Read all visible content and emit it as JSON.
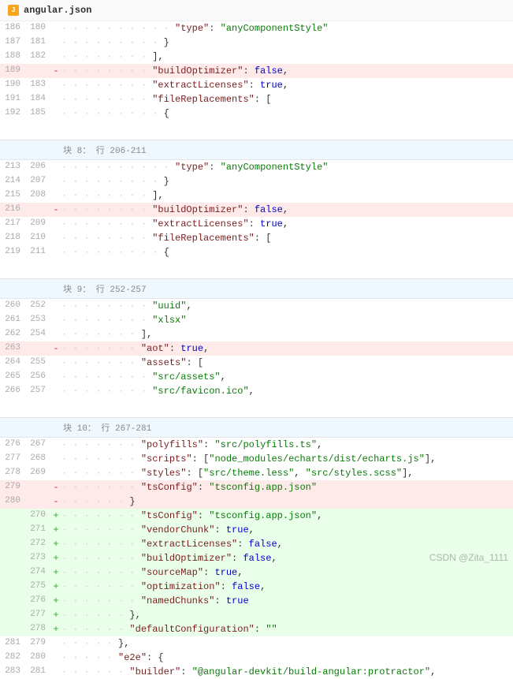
{
  "file": {
    "name": "angular.json",
    "icon_label": "J"
  },
  "watermark": "CSDN @Zita_1111",
  "hunks": [
    {
      "header": "",
      "lines": [
        {
          "old": "186",
          "new": "180",
          "type": "ctx",
          "indent": 20,
          "tokens": [
            [
              "key",
              "\"type\""
            ],
            [
              "punc",
              ": "
            ],
            [
              "str",
              "\"anyComponentStyle\""
            ]
          ]
        },
        {
          "old": "187",
          "new": "181",
          "type": "ctx",
          "indent": 18,
          "tokens": [
            [
              "punc",
              "}"
            ]
          ]
        },
        {
          "old": "188",
          "new": "182",
          "type": "ctx",
          "indent": 16,
          "tokens": [
            [
              "punc",
              "],"
            ]
          ]
        },
        {
          "old": "189",
          "new": "",
          "type": "del",
          "indent": 16,
          "tokens": [
            [
              "key",
              "\"buildOptimizer\""
            ],
            [
              "punc",
              ": "
            ],
            [
              "bool",
              "false"
            ],
            [
              "punc",
              ","
            ]
          ]
        },
        {
          "old": "190",
          "new": "183",
          "type": "ctx",
          "indent": 16,
          "tokens": [
            [
              "key",
              "\"extractLicenses\""
            ],
            [
              "punc",
              ": "
            ],
            [
              "bool",
              "true"
            ],
            [
              "punc",
              ","
            ]
          ]
        },
        {
          "old": "191",
          "new": "184",
          "type": "ctx",
          "indent": 16,
          "tokens": [
            [
              "key",
              "\"fileReplacements\""
            ],
            [
              "punc",
              ": ["
            ]
          ]
        },
        {
          "old": "192",
          "new": "185",
          "type": "ctx",
          "indent": 18,
          "tokens": [
            [
              "punc",
              "{"
            ]
          ]
        }
      ]
    },
    {
      "header": "块 8： 行 206-211",
      "lines": [
        {
          "old": "213",
          "new": "206",
          "type": "ctx",
          "indent": 20,
          "tokens": [
            [
              "key",
              "\"type\""
            ],
            [
              "punc",
              ": "
            ],
            [
              "str",
              "\"anyComponentStyle\""
            ]
          ]
        },
        {
          "old": "214",
          "new": "207",
          "type": "ctx",
          "indent": 18,
          "tokens": [
            [
              "punc",
              "}"
            ]
          ]
        },
        {
          "old": "215",
          "new": "208",
          "type": "ctx",
          "indent": 16,
          "tokens": [
            [
              "punc",
              "],"
            ]
          ]
        },
        {
          "old": "216",
          "new": "",
          "type": "del",
          "indent": 16,
          "tokens": [
            [
              "key",
              "\"buildOptimizer\""
            ],
            [
              "punc",
              ": "
            ],
            [
              "bool",
              "false"
            ],
            [
              "punc",
              ","
            ]
          ]
        },
        {
          "old": "217",
          "new": "209",
          "type": "ctx",
          "indent": 16,
          "tokens": [
            [
              "key",
              "\"extractLicenses\""
            ],
            [
              "punc",
              ": "
            ],
            [
              "bool",
              "true"
            ],
            [
              "punc",
              ","
            ]
          ]
        },
        {
          "old": "218",
          "new": "210",
          "type": "ctx",
          "indent": 16,
          "tokens": [
            [
              "key",
              "\"fileReplacements\""
            ],
            [
              "punc",
              ": ["
            ]
          ]
        },
        {
          "old": "219",
          "new": "211",
          "type": "ctx",
          "indent": 18,
          "tokens": [
            [
              "punc",
              "{"
            ]
          ]
        }
      ]
    },
    {
      "header": "块 9： 行 252-257",
      "lines": [
        {
          "old": "260",
          "new": "252",
          "type": "ctx",
          "indent": 16,
          "tokens": [
            [
              "str",
              "\"uuid\""
            ],
            [
              "punc",
              ","
            ]
          ]
        },
        {
          "old": "261",
          "new": "253",
          "type": "ctx",
          "indent": 16,
          "tokens": [
            [
              "str",
              "\"xlsx\""
            ]
          ]
        },
        {
          "old": "262",
          "new": "254",
          "type": "ctx",
          "indent": 14,
          "tokens": [
            [
              "punc",
              "],"
            ]
          ]
        },
        {
          "old": "263",
          "new": "",
          "type": "del",
          "indent": 14,
          "tokens": [
            [
              "key",
              "\"aot\""
            ],
            [
              "punc",
              ": "
            ],
            [
              "bool",
              "true"
            ],
            [
              "punc",
              ","
            ]
          ]
        },
        {
          "old": "264",
          "new": "255",
          "type": "ctx",
          "indent": 14,
          "tokens": [
            [
              "key",
              "\"assets\""
            ],
            [
              "punc",
              ": ["
            ]
          ]
        },
        {
          "old": "265",
          "new": "256",
          "type": "ctx",
          "indent": 16,
          "tokens": [
            [
              "str",
              "\"src/assets\""
            ],
            [
              "punc",
              ","
            ]
          ]
        },
        {
          "old": "266",
          "new": "257",
          "type": "ctx",
          "indent": 16,
          "tokens": [
            [
              "str",
              "\"src/favicon.ico\""
            ],
            [
              "punc",
              ","
            ]
          ]
        }
      ]
    },
    {
      "header": "块 10： 行 267-281",
      "lines": [
        {
          "old": "276",
          "new": "267",
          "type": "ctx",
          "indent": 14,
          "tokens": [
            [
              "key",
              "\"polyfills\""
            ],
            [
              "punc",
              ": "
            ],
            [
              "str",
              "\"src/polyfills.ts\""
            ],
            [
              "punc",
              ","
            ]
          ]
        },
        {
          "old": "277",
          "new": "268",
          "type": "ctx",
          "indent": 14,
          "tokens": [
            [
              "key",
              "\"scripts\""
            ],
            [
              "punc",
              ": ["
            ],
            [
              "str",
              "\"node_modules/echarts/dist/echarts.js\""
            ],
            [
              "punc",
              "],"
            ]
          ]
        },
        {
          "old": "278",
          "new": "269",
          "type": "ctx",
          "indent": 14,
          "tokens": [
            [
              "key",
              "\"styles\""
            ],
            [
              "punc",
              ": ["
            ],
            [
              "str",
              "\"src/theme.less\""
            ],
            [
              "punc",
              ", "
            ],
            [
              "str",
              "\"src/styles.scss\""
            ],
            [
              "punc",
              "],"
            ]
          ]
        },
        {
          "old": "279",
          "new": "",
          "type": "del",
          "indent": 14,
          "tokens": [
            [
              "key",
              "\"tsConfig\""
            ],
            [
              "punc",
              ": "
            ],
            [
              "str",
              "\"tsconfig.app.json\""
            ]
          ]
        },
        {
          "old": "280",
          "new": "",
          "type": "del",
          "indent": 12,
          "tokens": [
            [
              "punc",
              "}"
            ]
          ]
        },
        {
          "old": "",
          "new": "270",
          "type": "add",
          "indent": 14,
          "tokens": [
            [
              "key",
              "\"tsConfig\""
            ],
            [
              "punc",
              ": "
            ],
            [
              "str",
              "\"tsconfig.app.json\""
            ],
            [
              "punc",
              ","
            ]
          ]
        },
        {
          "old": "",
          "new": "271",
          "type": "add",
          "indent": 14,
          "tokens": [
            [
              "key",
              "\"vendorChunk\""
            ],
            [
              "punc",
              ": "
            ],
            [
              "bool",
              "true"
            ],
            [
              "punc",
              ","
            ]
          ]
        },
        {
          "old": "",
          "new": "272",
          "type": "add",
          "indent": 14,
          "tokens": [
            [
              "key",
              "\"extractLicenses\""
            ],
            [
              "punc",
              ": "
            ],
            [
              "bool",
              "false"
            ],
            [
              "punc",
              ","
            ]
          ]
        },
        {
          "old": "",
          "new": "273",
          "type": "add",
          "indent": 14,
          "tokens": [
            [
              "key",
              "\"buildOptimizer\""
            ],
            [
              "punc",
              ": "
            ],
            [
              "bool",
              "false"
            ],
            [
              "punc",
              ","
            ]
          ]
        },
        {
          "old": "",
          "new": "274",
          "type": "add",
          "indent": 14,
          "tokens": [
            [
              "key",
              "\"sourceMap\""
            ],
            [
              "punc",
              ": "
            ],
            [
              "bool",
              "true"
            ],
            [
              "punc",
              ","
            ]
          ]
        },
        {
          "old": "",
          "new": "275",
          "type": "add",
          "indent": 14,
          "tokens": [
            [
              "key",
              "\"optimization\""
            ],
            [
              "punc",
              ": "
            ],
            [
              "bool",
              "false"
            ],
            [
              "punc",
              ","
            ]
          ]
        },
        {
          "old": "",
          "new": "276",
          "type": "add",
          "indent": 14,
          "tokens": [
            [
              "key",
              "\"namedChunks\""
            ],
            [
              "punc",
              ": "
            ],
            [
              "bool",
              "true"
            ]
          ]
        },
        {
          "old": "",
          "new": "277",
          "type": "add",
          "indent": 12,
          "tokens": [
            [
              "punc",
              "},"
            ]
          ]
        },
        {
          "old": "",
          "new": "278",
          "type": "add",
          "indent": 12,
          "tokens": [
            [
              "key",
              "\"defaultConfiguration\""
            ],
            [
              "punc",
              ": "
            ],
            [
              "str",
              "\"\""
            ]
          ]
        },
        {
          "old": "281",
          "new": "279",
          "type": "ctx",
          "indent": 10,
          "tokens": [
            [
              "punc",
              "},"
            ]
          ]
        },
        {
          "old": "282",
          "new": "280",
          "type": "ctx",
          "indent": 10,
          "tokens": [
            [
              "key",
              "\"e2e\""
            ],
            [
              "punc",
              ": {"
            ]
          ]
        },
        {
          "old": "283",
          "new": "281",
          "type": "ctx",
          "indent": 12,
          "tokens": [
            [
              "key",
              "\"builder\""
            ],
            [
              "punc",
              ": "
            ],
            [
              "str",
              "\"@angular-devkit/build-angular:protractor\""
            ],
            [
              "punc",
              ","
            ]
          ]
        }
      ]
    }
  ]
}
